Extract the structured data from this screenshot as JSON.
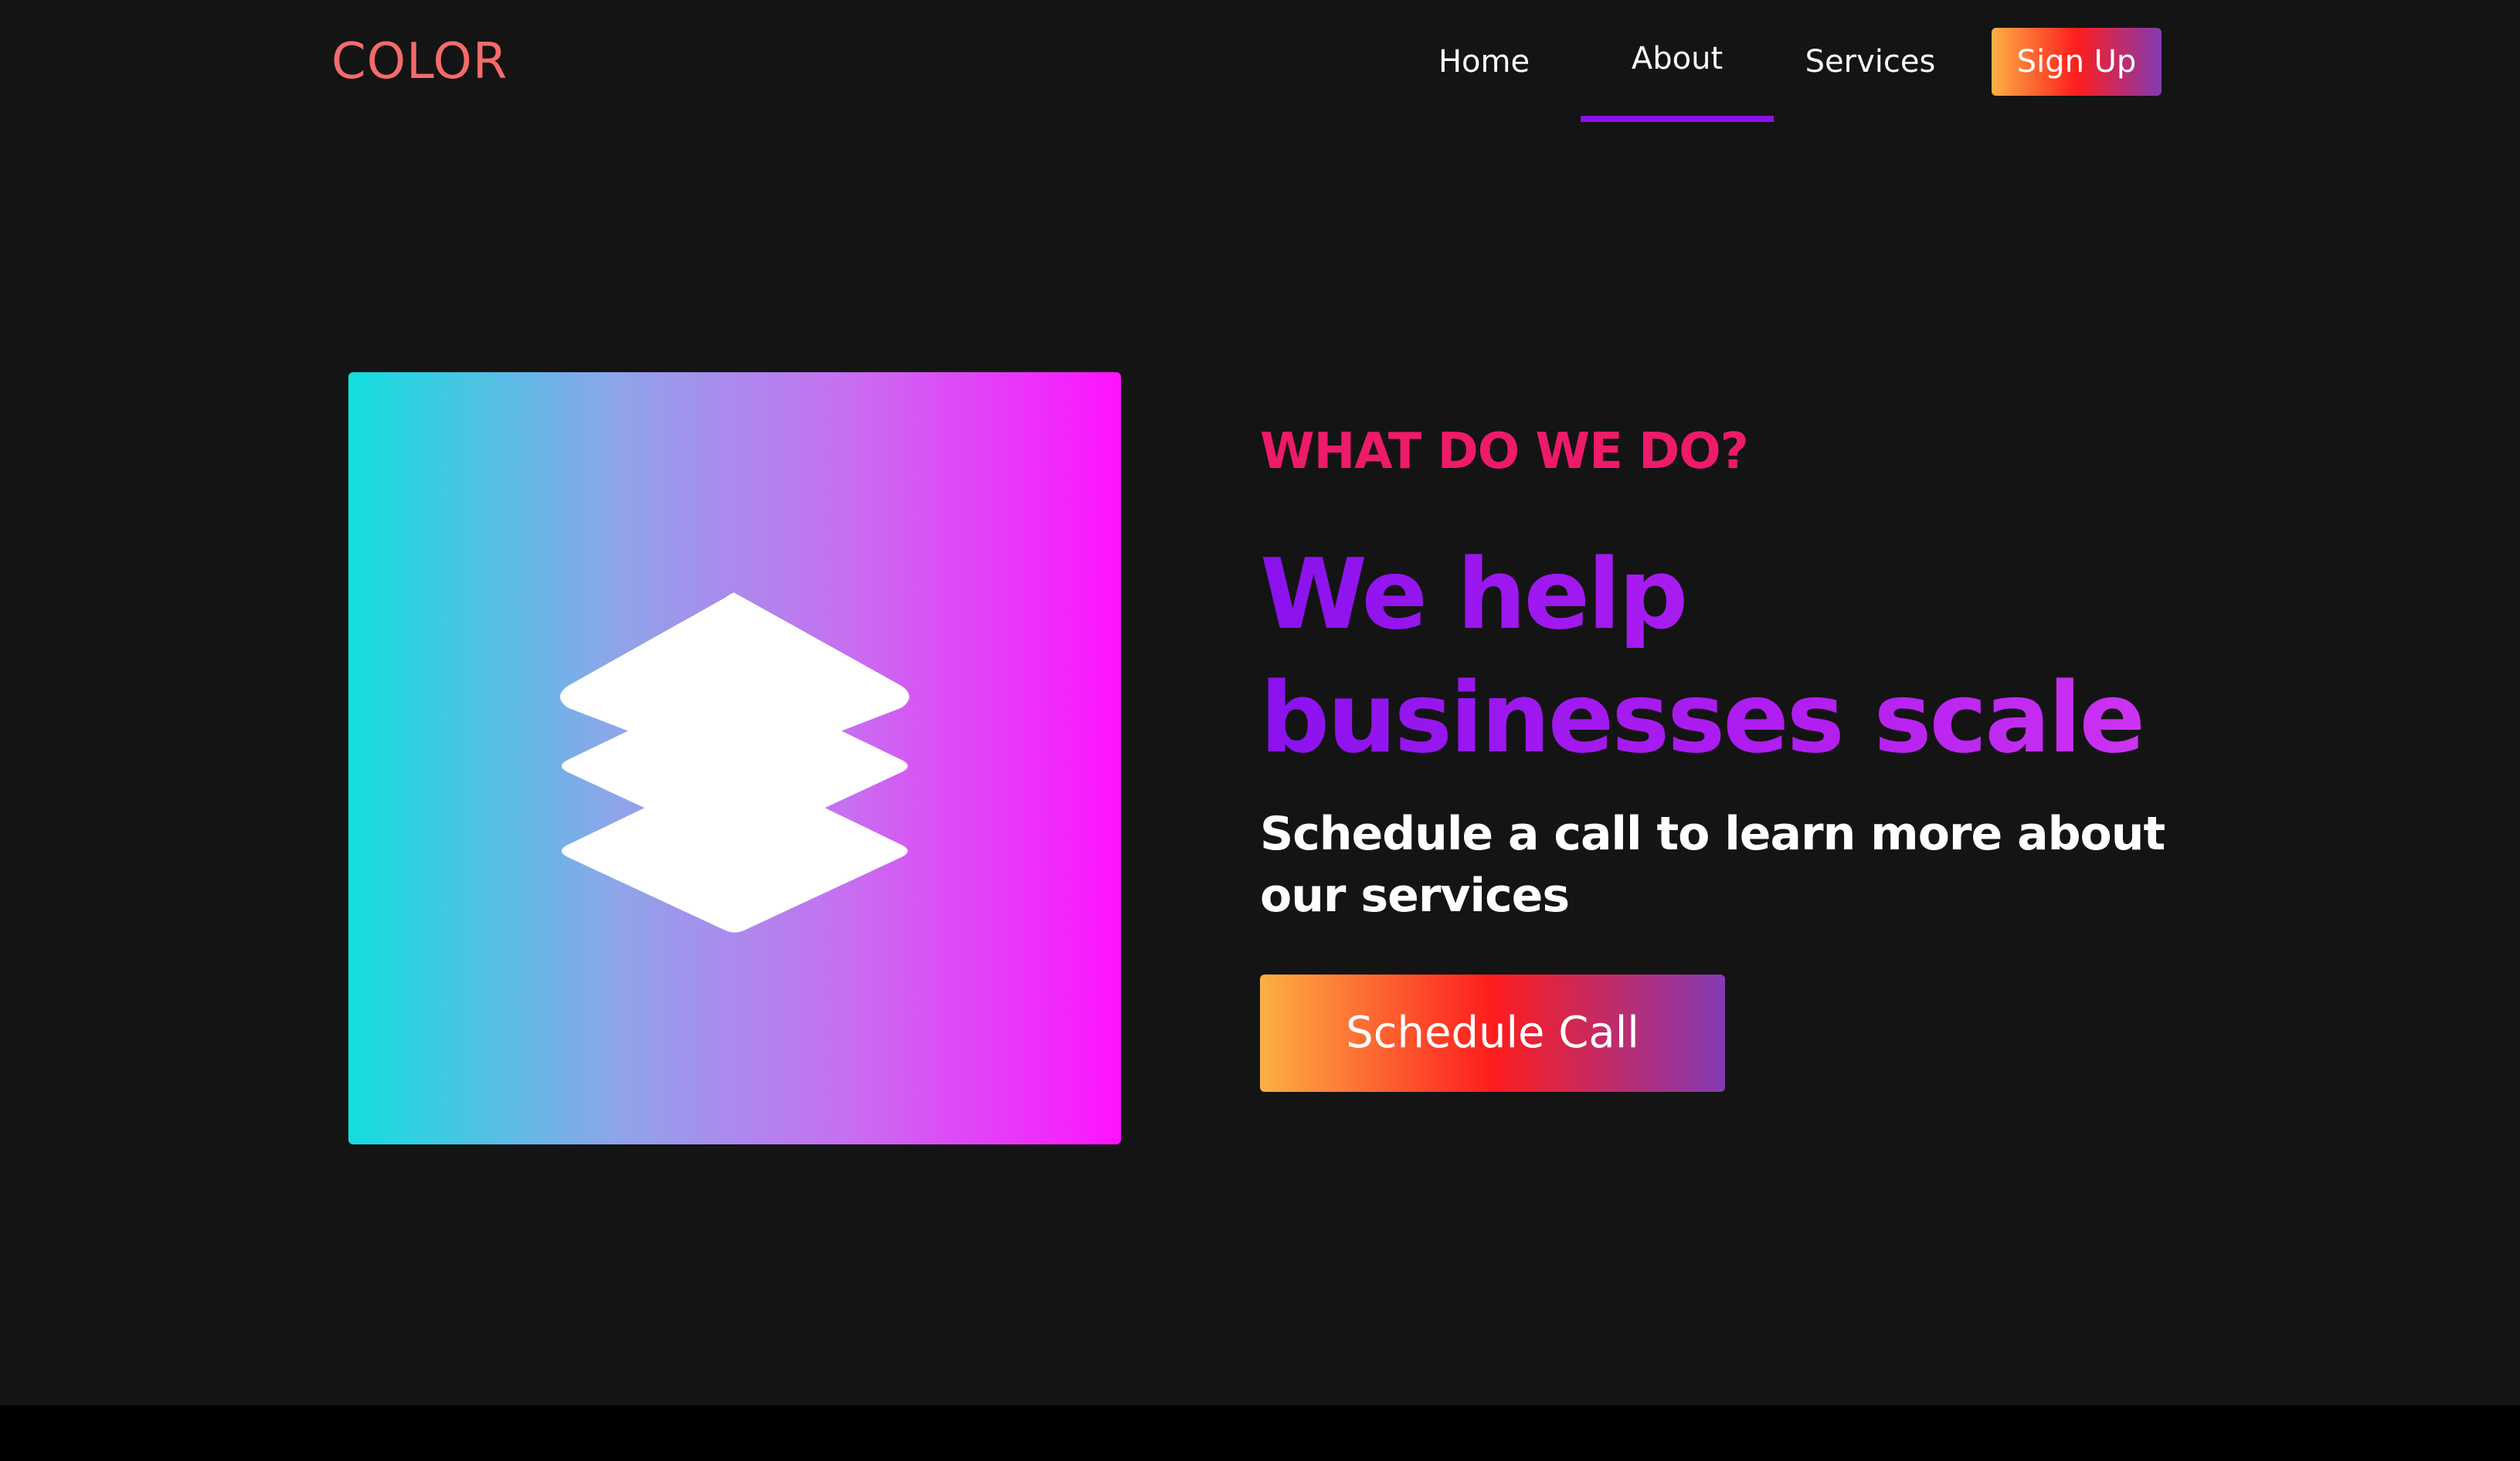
{
  "brand": {
    "logo_text": "COLOR",
    "logo_color": "#f46b6b"
  },
  "nav": {
    "items": [
      {
        "label": "Home",
        "active": false
      },
      {
        "label": "About",
        "active": true
      },
      {
        "label": "Services",
        "active": false
      }
    ],
    "signup_label": "Sign Up",
    "active_underline_color": "#8a12e8"
  },
  "hero": {
    "image_icon": "layers-icon",
    "image_gradient": [
      "#12dede",
      "#ff12ff"
    ],
    "eyebrow": "WHAT DO WE DO?",
    "headline": "We help businesses scale",
    "subtitle": "Schedule a call to learn more about our services",
    "cta_label": "Schedule Call"
  },
  "colors": {
    "background": "#141414",
    "eyebrow": "#ee1a6a",
    "headline": "#8a12ee",
    "button_gradient": [
      "#fcb045",
      "#fd1d1d",
      "#833ab4"
    ]
  }
}
